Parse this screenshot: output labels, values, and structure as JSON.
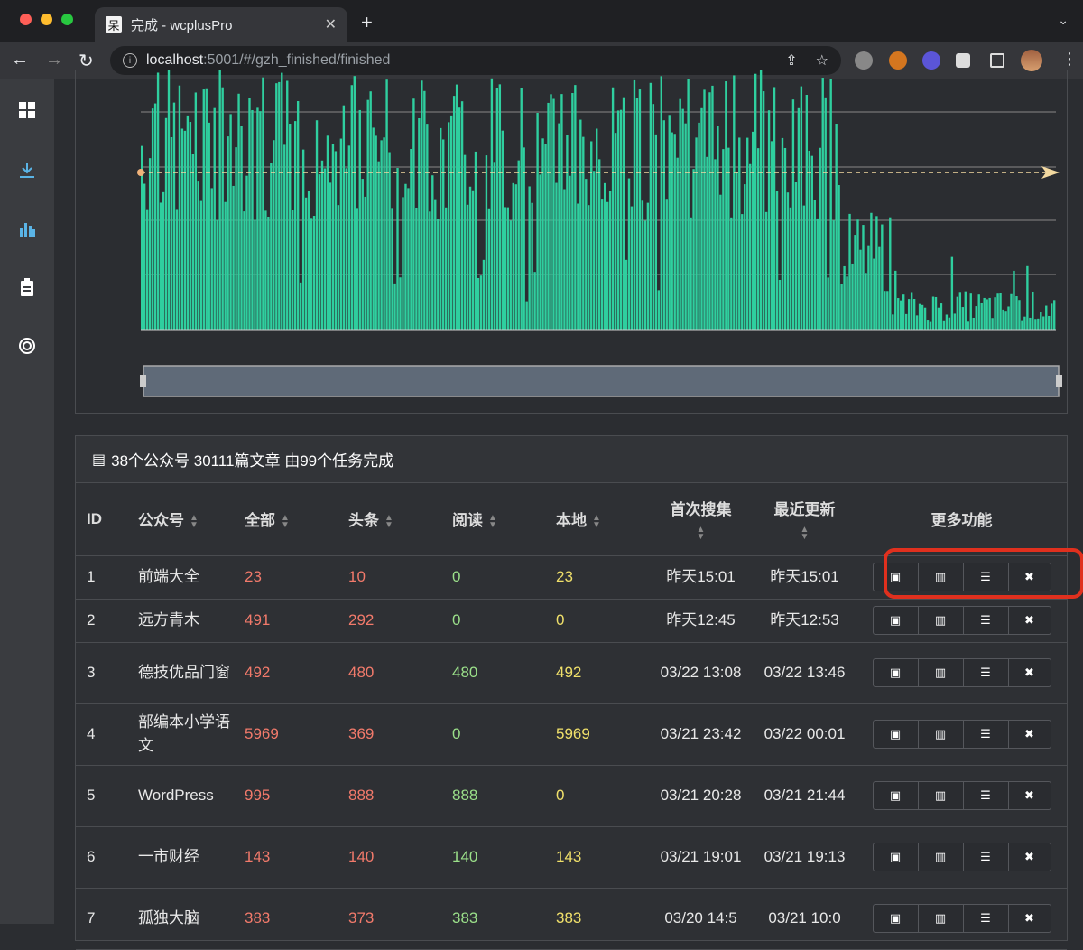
{
  "browser": {
    "tab_title": "完成 - wcplusPro",
    "favicon": "呆",
    "url_host": "localhost",
    "url_rest": ":5001/#/gzh_finished/finished"
  },
  "table": {
    "summary": "38个公众号 30111篇文章 由99个任务完成",
    "headers": {
      "id": "ID",
      "name": "公众号",
      "all": "全部",
      "top": "头条",
      "read": "阅读",
      "local": "本地",
      "first": "首次搜集",
      "last": "最近更新",
      "more": "更多功能"
    },
    "rows": [
      {
        "id": "1",
        "name": "前端大全",
        "all": "23",
        "top": "10",
        "read": "0",
        "local": "23",
        "first": "昨天15:01",
        "last": "昨天15:01"
      },
      {
        "id": "2",
        "name": "远方青木",
        "all": "491",
        "top": "292",
        "read": "0",
        "local": "0",
        "first": "昨天12:45",
        "last": "昨天12:53"
      },
      {
        "id": "3",
        "name": "德技优品门窗",
        "all": "492",
        "top": "480",
        "read": "480",
        "local": "492",
        "first": "03/22 13:08",
        "last": "03/22 13:46"
      },
      {
        "id": "4",
        "name": "部编本小学语文",
        "all": "5969",
        "top": "369",
        "read": "0",
        "local": "5969",
        "first": "03/21 23:42",
        "last": "03/22 00:01"
      },
      {
        "id": "5",
        "name": "WordPress",
        "all": "995",
        "top": "888",
        "read": "888",
        "local": "0",
        "first": "03/21 20:28",
        "last": "03/21 21:44"
      },
      {
        "id": "6",
        "name": "一市财经",
        "all": "143",
        "top": "140",
        "read": "140",
        "local": "143",
        "first": "03/21 19:01",
        "last": "03/21 19:13"
      },
      {
        "id": "7",
        "name": "孤独大脑",
        "all": "383",
        "top": "373",
        "read": "383",
        "local": "383",
        "first": "03/20 14:5",
        "last": "03/21 10:0"
      }
    ]
  },
  "colors": {
    "bar": "#2fcf9f",
    "accent": "#e0301e"
  }
}
